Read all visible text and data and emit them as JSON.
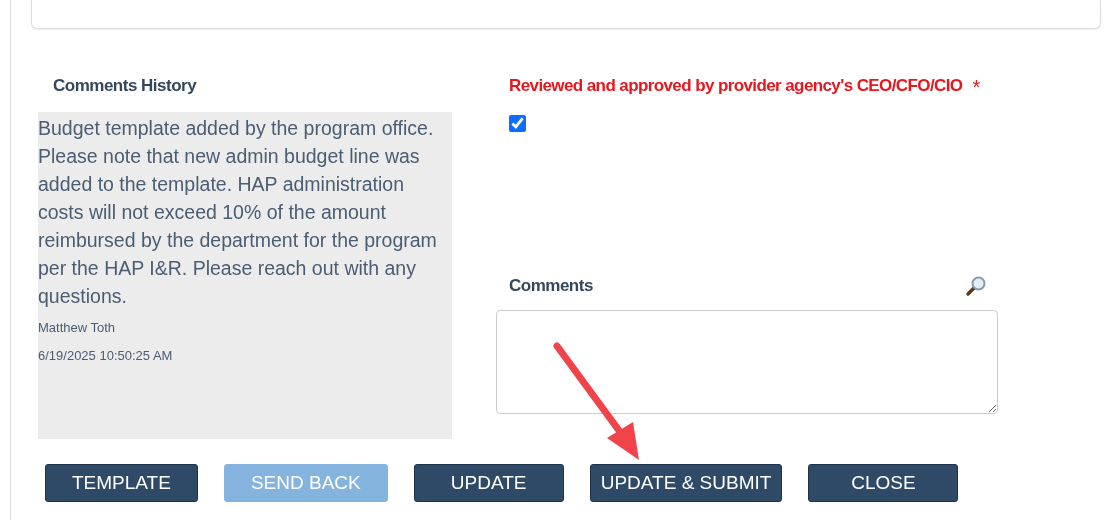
{
  "comments_history": {
    "label": "Comments History",
    "entries": [
      {
        "text": "Budget template added by the program office. Please note that new admin budget line was added to the template. HAP administration costs will not exceed 10% of the amount reimbursed by the department for the program per the HAP I&R. Please reach out with any questions.",
        "author": "Matthew Toth",
        "timestamp": "6/19/2025 10:50:25 AM"
      }
    ]
  },
  "approval": {
    "label": "Reviewed and approved by provider agency's CEO/CFO/CIO",
    "required_mark": "*",
    "checked": true
  },
  "comments": {
    "label": "Comments"
  },
  "buttons": [
    {
      "label": "TEMPLATE",
      "disabled": false
    },
    {
      "label": "SEND BACK",
      "disabled": true
    },
    {
      "label": "UPDATE",
      "disabled": false
    },
    {
      "label": "UPDATE & SUBMIT",
      "disabled": false
    },
    {
      "label": "CLOSE",
      "disabled": false
    }
  ]
}
